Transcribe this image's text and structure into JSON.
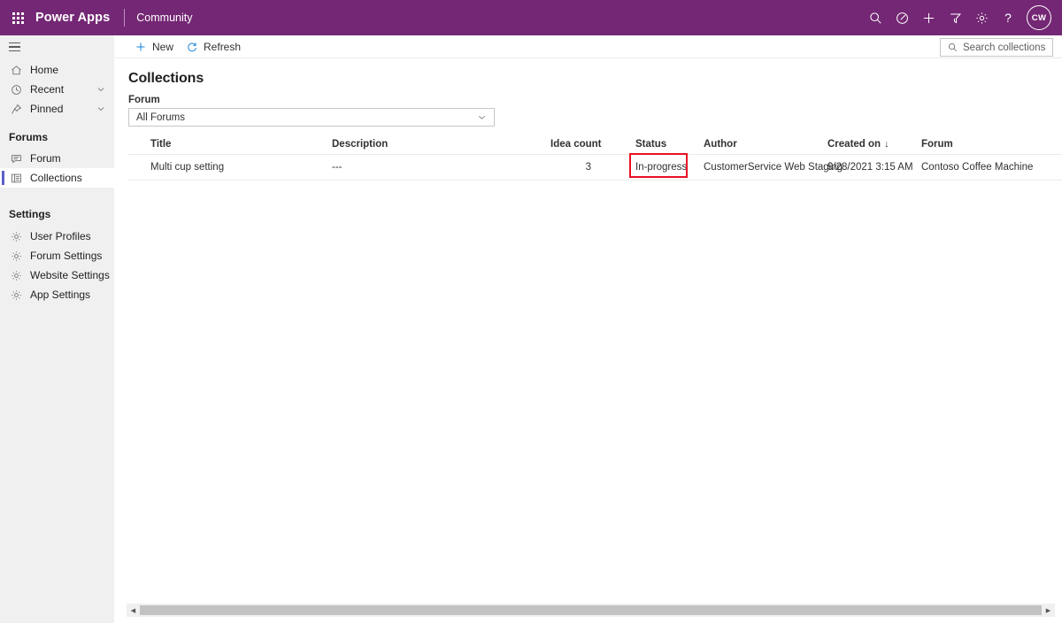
{
  "header": {
    "waffle_label": "app-launcher",
    "brand": "Power Apps",
    "app_name": "Community",
    "actions": [
      {
        "name": "search-icon",
        "label": "Search"
      },
      {
        "name": "environment-icon",
        "label": "Environment"
      },
      {
        "name": "plus-icon",
        "label": "New"
      },
      {
        "name": "filter-icon",
        "label": "Filter"
      },
      {
        "name": "gear-icon",
        "label": "Settings"
      },
      {
        "name": "help-icon",
        "label": "Help"
      }
    ],
    "avatar_initials": "CW",
    "brand_color": "#742774"
  },
  "sidebar": {
    "hamburger_label": "Toggle navigation",
    "items": [
      {
        "label": "Home",
        "icon": "home-icon",
        "expandable": false
      },
      {
        "label": "Recent",
        "icon": "clock-icon",
        "expandable": true
      },
      {
        "label": "Pinned",
        "icon": "pin-icon",
        "expandable": true
      }
    ],
    "groups": [
      {
        "title": "Forums",
        "items": [
          {
            "label": "Forum",
            "icon": "chat-icon",
            "selected": false
          },
          {
            "label": "Collections",
            "icon": "list-icon",
            "selected": true
          }
        ]
      },
      {
        "title": "Settings",
        "items": [
          {
            "label": "User Profiles",
            "icon": "gear-icon",
            "selected": false
          },
          {
            "label": "Forum Settings",
            "icon": "gear-icon",
            "selected": false
          },
          {
            "label": "Website Settings",
            "icon": "gear-icon",
            "selected": false
          },
          {
            "label": "App Settings",
            "icon": "gear-icon",
            "selected": false
          }
        ]
      }
    ],
    "selected_indicator_color": "#5b5fc7"
  },
  "command_bar": {
    "new_label": "New",
    "refresh_label": "Refresh",
    "icon_color": "#0078d4"
  },
  "search": {
    "placeholder": "Search collections",
    "value": ""
  },
  "main": {
    "page_title": "Collections",
    "filter_label": "Forum",
    "filter_value": "All Forums"
  },
  "table": {
    "columns": [
      {
        "key": "title",
        "label": "Title",
        "sorted": false
      },
      {
        "key": "desc",
        "label": "Description",
        "sorted": false
      },
      {
        "key": "idea",
        "label": "Idea count",
        "sorted": false
      },
      {
        "key": "status",
        "label": "Status",
        "sorted": false
      },
      {
        "key": "author",
        "label": "Author",
        "sorted": false
      },
      {
        "key": "created",
        "label": "Created on",
        "sorted": true,
        "sort_arrow": "↓"
      },
      {
        "key": "forum",
        "label": "Forum",
        "sorted": false
      }
    ],
    "rows": [
      {
        "title": "Multi cup setting",
        "desc": "---",
        "idea": "3",
        "status": "In-progress",
        "author": "CustomerService Web Staging",
        "created": "9/28/2021 3:15 AM",
        "forum": "Contoso Coffee Machine"
      }
    ]
  },
  "annotation": {
    "highlight_target": "status-cell",
    "color": "#e81123"
  },
  "scrollbar": {
    "left_arrow": "◀",
    "right_arrow": "▶"
  }
}
